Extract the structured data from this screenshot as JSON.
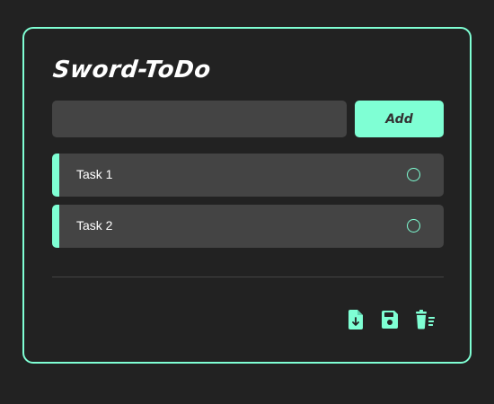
{
  "app": {
    "title": "Sword-ToDo"
  },
  "new_task": {
    "value": "",
    "placeholder": "",
    "add_label": "Add"
  },
  "tasks": [
    {
      "label": "Task 1",
      "done": false
    },
    {
      "label": "Task 2",
      "done": false
    }
  ],
  "toolbar": {
    "icons": [
      "file-download-icon",
      "save-icon",
      "delete-all-icon"
    ]
  },
  "colors": {
    "accent": "#7fffd4",
    "background": "#222222",
    "surface": "#444444",
    "text": "#ffffff"
  }
}
